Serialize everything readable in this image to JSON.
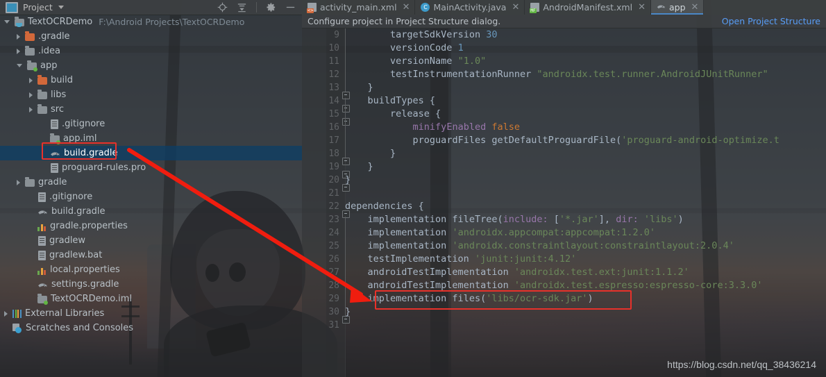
{
  "toolwindow": {
    "title": "Project",
    "icon": "project-icon",
    "dropdown_icon": "chevron-down-icon",
    "actions": [
      {
        "name": "locate-icon",
        "label": "Select Opened File"
      },
      {
        "name": "collapse-all-icon",
        "label": "Collapse All"
      },
      {
        "name": "gear-icon",
        "label": "Settings"
      },
      {
        "name": "minimize-icon",
        "label": "Hide"
      }
    ]
  },
  "tree": {
    "root": {
      "label": "TextOCRDemo",
      "path": "F:\\Android Projects\\TextOCRDemo",
      "icon": "module-icon",
      "expanded": true
    },
    "items": [
      {
        "label": ".gradle",
        "icon": "folder-orange-icon",
        "indent": 1,
        "arrow": "collapsed",
        "selected": false
      },
      {
        "label": ".idea",
        "icon": "folder-icon",
        "indent": 1,
        "arrow": "collapsed",
        "selected": false
      },
      {
        "label": "app",
        "icon": "module-folder-icon",
        "indent": 1,
        "arrow": "expanded",
        "selected": false
      },
      {
        "label": "build",
        "icon": "folder-orange-icon",
        "indent": 2,
        "arrow": "collapsed",
        "selected": false
      },
      {
        "label": "libs",
        "icon": "folder-icon",
        "indent": 2,
        "arrow": "collapsed",
        "selected": false
      },
      {
        "label": "src",
        "icon": "folder-icon",
        "indent": 2,
        "arrow": "collapsed",
        "selected": false
      },
      {
        "label": ".gitignore",
        "icon": "file-icon",
        "indent": 3,
        "arrow": "none",
        "selected": false
      },
      {
        "label": "app.iml",
        "icon": "module-folder-icon",
        "indent": 3,
        "arrow": "none",
        "selected": false
      },
      {
        "label": "build.gradle",
        "icon": "gradle-icon",
        "indent": 3,
        "arrow": "none",
        "selected": true
      },
      {
        "label": "proguard-rules.pro",
        "icon": "file-icon",
        "indent": 3,
        "arrow": "none",
        "selected": false
      },
      {
        "label": "gradle",
        "icon": "folder-icon",
        "indent": 1,
        "arrow": "collapsed",
        "selected": false
      },
      {
        "label": ".gitignore",
        "icon": "file-icon",
        "indent": 2,
        "arrow": "none",
        "selected": false
      },
      {
        "label": "build.gradle",
        "icon": "gradle-icon",
        "indent": 2,
        "arrow": "none",
        "selected": false
      },
      {
        "label": "gradle.properties",
        "icon": "properties-icon",
        "indent": 2,
        "arrow": "none",
        "selected": false
      },
      {
        "label": "gradlew",
        "icon": "file-icon",
        "indent": 2,
        "arrow": "none",
        "selected": false
      },
      {
        "label": "gradlew.bat",
        "icon": "file-icon",
        "indent": 2,
        "arrow": "none",
        "selected": false
      },
      {
        "label": "local.properties",
        "icon": "properties-icon",
        "indent": 2,
        "arrow": "none",
        "selected": false
      },
      {
        "label": "settings.gradle",
        "icon": "gradle-icon",
        "indent": 2,
        "arrow": "none",
        "selected": false
      },
      {
        "label": "TextOCRDemo.iml",
        "icon": "module-folder-icon",
        "indent": 2,
        "arrow": "none",
        "selected": false
      },
      {
        "label": "External Libraries",
        "icon": "libraries-icon",
        "indent": 0,
        "arrow": "collapsed",
        "selected": false
      },
      {
        "label": "Scratches and Consoles",
        "icon": "scratches-icon",
        "indent": 0,
        "arrow": "none",
        "selected": false
      }
    ]
  },
  "tabs": [
    {
      "label": "activity_main.xml",
      "icon": "xml-file-icon",
      "active": false,
      "closable": true
    },
    {
      "label": "MainActivity.java",
      "icon": "java-class-icon",
      "active": false,
      "closable": true
    },
    {
      "label": "AndroidManifest.xml",
      "icon": "manifest-file-icon",
      "active": false,
      "closable": true
    },
    {
      "label": "app",
      "icon": "gradle-icon",
      "active": true,
      "closable": true
    }
  ],
  "notification": {
    "message": "Configure project in Project Structure dialog.",
    "link": "Open Project Structure"
  },
  "editor": {
    "first_line_number": 9,
    "lines": [
      {
        "n": 9,
        "indent": 8,
        "tokens": [
          {
            "t": "targetSdkVersion ",
            "c": "fn"
          },
          {
            "t": "30",
            "c": "num"
          }
        ]
      },
      {
        "n": 10,
        "indent": 8,
        "tokens": [
          {
            "t": "versionCode ",
            "c": "fn"
          },
          {
            "t": "1",
            "c": "num"
          }
        ]
      },
      {
        "n": 11,
        "indent": 8,
        "tokens": [
          {
            "t": "versionName ",
            "c": "fn"
          },
          {
            "t": "\"1.0\"",
            "c": "str"
          }
        ]
      },
      {
        "n": 12,
        "indent": 8,
        "tokens": [
          {
            "t": "testInstrumentationRunner ",
            "c": "fn"
          },
          {
            "t": "\"androidx.test.runner.AndroidJUnitRunner\"",
            "c": "str"
          }
        ]
      },
      {
        "n": 13,
        "indent": 4,
        "tokens": [
          {
            "t": "}",
            "c": "brk"
          }
        ]
      },
      {
        "n": 14,
        "indent": 4,
        "tokens": [
          {
            "t": "buildTypes {",
            "c": "fn"
          }
        ]
      },
      {
        "n": 15,
        "indent": 8,
        "tokens": [
          {
            "t": "release {",
            "c": "fn"
          }
        ]
      },
      {
        "n": 16,
        "indent": 12,
        "tokens": [
          {
            "t": "minifyEnabled ",
            "c": "prop"
          },
          {
            "t": "false",
            "c": "kw"
          }
        ]
      },
      {
        "n": 17,
        "indent": 12,
        "tokens": [
          {
            "t": "proguardFiles getDefaultProguardFile(",
            "c": "fn"
          },
          {
            "t": "'proguard-android-optimize.t",
            "c": "str"
          }
        ]
      },
      {
        "n": 18,
        "indent": 8,
        "tokens": [
          {
            "t": "}",
            "c": "brk"
          }
        ]
      },
      {
        "n": 19,
        "indent": 4,
        "tokens": [
          {
            "t": "}",
            "c": "brk"
          }
        ]
      },
      {
        "n": 20,
        "indent": 0,
        "tokens": [
          {
            "t": "}",
            "c": "brk"
          }
        ]
      },
      {
        "n": 21,
        "indent": 0,
        "tokens": []
      },
      {
        "n": 22,
        "indent": 0,
        "tokens": [
          {
            "t": "dependencies {",
            "c": "fn"
          }
        ]
      },
      {
        "n": 23,
        "indent": 4,
        "tokens": [
          {
            "t": "implementation fileTree(",
            "c": "fn"
          },
          {
            "t": "include:",
            "c": "prop"
          },
          {
            "t": " [",
            "c": "brk"
          },
          {
            "t": "'*.jar'",
            "c": "str"
          },
          {
            "t": "], ",
            "c": "brk"
          },
          {
            "t": "dir:",
            "c": "prop"
          },
          {
            "t": " ",
            "c": "brk"
          },
          {
            "t": "'libs'",
            "c": "str"
          },
          {
            "t": ")",
            "c": "brk"
          }
        ]
      },
      {
        "n": 24,
        "indent": 4,
        "tokens": [
          {
            "t": "implementation ",
            "c": "fn"
          },
          {
            "t": "'androidx.appcompat:appcompat:1.2.0'",
            "c": "str"
          }
        ]
      },
      {
        "n": 25,
        "indent": 4,
        "tokens": [
          {
            "t": "implementation ",
            "c": "fn"
          },
          {
            "t": "'androidx.constraintlayout:constraintlayout:2.0.4'",
            "c": "str"
          }
        ]
      },
      {
        "n": 26,
        "indent": 4,
        "tokens": [
          {
            "t": "testImplementation ",
            "c": "fn"
          },
          {
            "t": "'junit:junit:4.12'",
            "c": "str"
          }
        ]
      },
      {
        "n": 27,
        "indent": 4,
        "tokens": [
          {
            "t": "androidTestImplementation ",
            "c": "fn"
          },
          {
            "t": "'androidx.test.ext:junit:1.1.2'",
            "c": "str"
          }
        ]
      },
      {
        "n": 28,
        "indent": 4,
        "tokens": [
          {
            "t": "androidTestImplementation ",
            "c": "fn"
          },
          {
            "t": "'androidx.test.espresso:espresso-core:3.3.0'",
            "c": "str"
          }
        ]
      },
      {
        "n": 29,
        "indent": 4,
        "tokens": [
          {
            "t": "implementation files(",
            "c": "fn"
          },
          {
            "t": "'libs/ocr-sdk.jar'",
            "c": "str"
          },
          {
            "t": ")",
            "c": "brk"
          }
        ]
      },
      {
        "n": 30,
        "indent": 0,
        "tokens": [
          {
            "t": "}",
            "c": "brk"
          }
        ]
      },
      {
        "n": 31,
        "indent": 0,
        "tokens": []
      }
    ]
  },
  "annotations": {
    "highlight_color": "#e8312a",
    "tree_highlight_target": "build.gradle",
    "code_highlight_target": "implementation files('libs/ocr-sdk.jar')",
    "arrow_label": "red-arrow-pointing-from-build-gradle-to-code-line"
  },
  "watermark": {
    "text": "https://blog.csdn.net/qq_38436214"
  },
  "colors": {
    "accent": "#4a88c7",
    "selection": "#0d3d64",
    "string": "#6a8759",
    "keyword": "#cc7832",
    "number": "#6897bb",
    "property": "#9876aa",
    "link": "#589df6",
    "annotation_red": "#e8312a"
  }
}
